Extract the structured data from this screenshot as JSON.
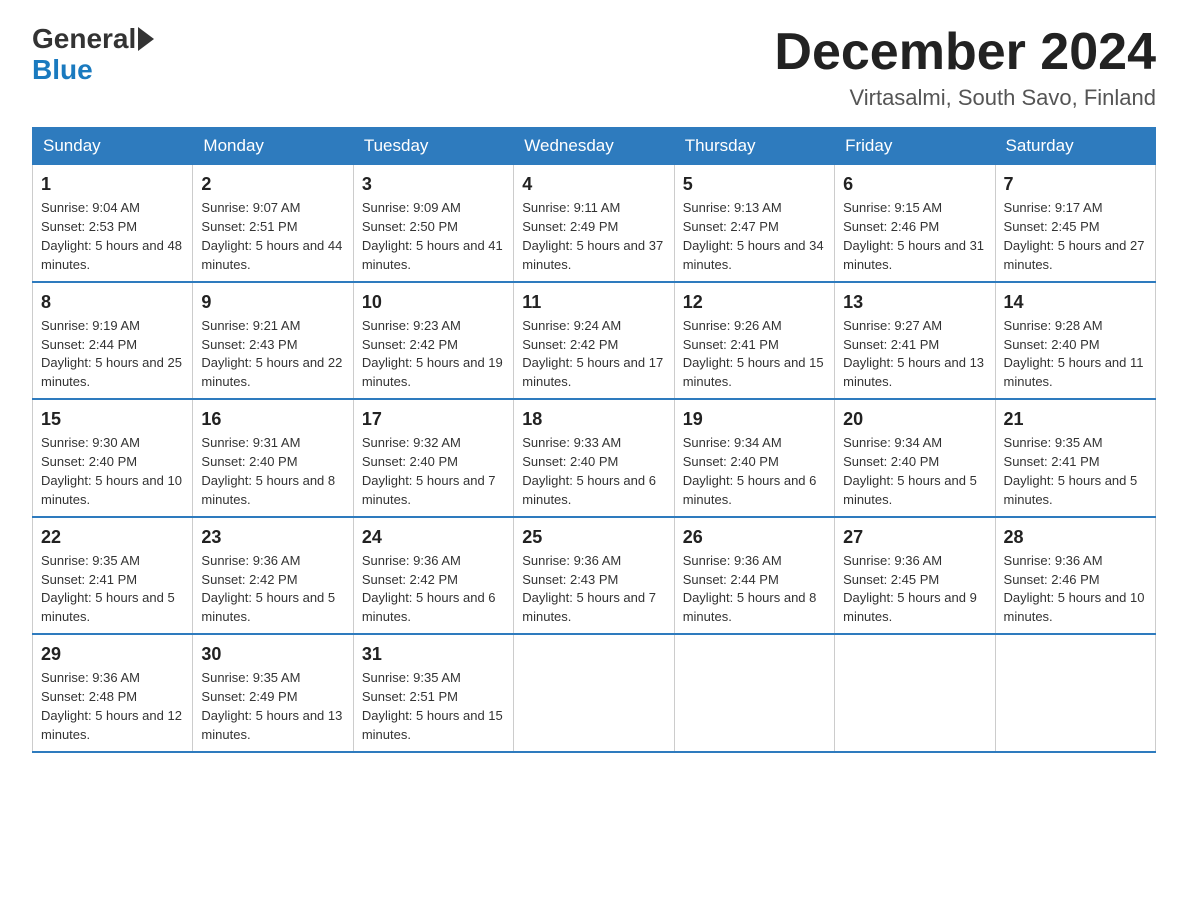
{
  "header": {
    "logo_general": "General",
    "logo_blue": "Blue",
    "month_title": "December 2024",
    "location": "Virtasalmi, South Savo, Finland"
  },
  "weekdays": [
    "Sunday",
    "Monday",
    "Tuesday",
    "Wednesday",
    "Thursday",
    "Friday",
    "Saturday"
  ],
  "weeks": [
    [
      {
        "day": "1",
        "sunrise": "9:04 AM",
        "sunset": "2:53 PM",
        "daylight": "5 hours and 48 minutes."
      },
      {
        "day": "2",
        "sunrise": "9:07 AM",
        "sunset": "2:51 PM",
        "daylight": "5 hours and 44 minutes."
      },
      {
        "day": "3",
        "sunrise": "9:09 AM",
        "sunset": "2:50 PM",
        "daylight": "5 hours and 41 minutes."
      },
      {
        "day": "4",
        "sunrise": "9:11 AM",
        "sunset": "2:49 PM",
        "daylight": "5 hours and 37 minutes."
      },
      {
        "day": "5",
        "sunrise": "9:13 AM",
        "sunset": "2:47 PM",
        "daylight": "5 hours and 34 minutes."
      },
      {
        "day": "6",
        "sunrise": "9:15 AM",
        "sunset": "2:46 PM",
        "daylight": "5 hours and 31 minutes."
      },
      {
        "day": "7",
        "sunrise": "9:17 AM",
        "sunset": "2:45 PM",
        "daylight": "5 hours and 27 minutes."
      }
    ],
    [
      {
        "day": "8",
        "sunrise": "9:19 AM",
        "sunset": "2:44 PM",
        "daylight": "5 hours and 25 minutes."
      },
      {
        "day": "9",
        "sunrise": "9:21 AM",
        "sunset": "2:43 PM",
        "daylight": "5 hours and 22 minutes."
      },
      {
        "day": "10",
        "sunrise": "9:23 AM",
        "sunset": "2:42 PM",
        "daylight": "5 hours and 19 minutes."
      },
      {
        "day": "11",
        "sunrise": "9:24 AM",
        "sunset": "2:42 PM",
        "daylight": "5 hours and 17 minutes."
      },
      {
        "day": "12",
        "sunrise": "9:26 AM",
        "sunset": "2:41 PM",
        "daylight": "5 hours and 15 minutes."
      },
      {
        "day": "13",
        "sunrise": "9:27 AM",
        "sunset": "2:41 PM",
        "daylight": "5 hours and 13 minutes."
      },
      {
        "day": "14",
        "sunrise": "9:28 AM",
        "sunset": "2:40 PM",
        "daylight": "5 hours and 11 minutes."
      }
    ],
    [
      {
        "day": "15",
        "sunrise": "9:30 AM",
        "sunset": "2:40 PM",
        "daylight": "5 hours and 10 minutes."
      },
      {
        "day": "16",
        "sunrise": "9:31 AM",
        "sunset": "2:40 PM",
        "daylight": "5 hours and 8 minutes."
      },
      {
        "day": "17",
        "sunrise": "9:32 AM",
        "sunset": "2:40 PM",
        "daylight": "5 hours and 7 minutes."
      },
      {
        "day": "18",
        "sunrise": "9:33 AM",
        "sunset": "2:40 PM",
        "daylight": "5 hours and 6 minutes."
      },
      {
        "day": "19",
        "sunrise": "9:34 AM",
        "sunset": "2:40 PM",
        "daylight": "5 hours and 6 minutes."
      },
      {
        "day": "20",
        "sunrise": "9:34 AM",
        "sunset": "2:40 PM",
        "daylight": "5 hours and 5 minutes."
      },
      {
        "day": "21",
        "sunrise": "9:35 AM",
        "sunset": "2:41 PM",
        "daylight": "5 hours and 5 minutes."
      }
    ],
    [
      {
        "day": "22",
        "sunrise": "9:35 AM",
        "sunset": "2:41 PM",
        "daylight": "5 hours and 5 minutes."
      },
      {
        "day": "23",
        "sunrise": "9:36 AM",
        "sunset": "2:42 PM",
        "daylight": "5 hours and 5 minutes."
      },
      {
        "day": "24",
        "sunrise": "9:36 AM",
        "sunset": "2:42 PM",
        "daylight": "5 hours and 6 minutes."
      },
      {
        "day": "25",
        "sunrise": "9:36 AM",
        "sunset": "2:43 PM",
        "daylight": "5 hours and 7 minutes."
      },
      {
        "day": "26",
        "sunrise": "9:36 AM",
        "sunset": "2:44 PM",
        "daylight": "5 hours and 8 minutes."
      },
      {
        "day": "27",
        "sunrise": "9:36 AM",
        "sunset": "2:45 PM",
        "daylight": "5 hours and 9 minutes."
      },
      {
        "day": "28",
        "sunrise": "9:36 AM",
        "sunset": "2:46 PM",
        "daylight": "5 hours and 10 minutes."
      }
    ],
    [
      {
        "day": "29",
        "sunrise": "9:36 AM",
        "sunset": "2:48 PM",
        "daylight": "5 hours and 12 minutes."
      },
      {
        "day": "30",
        "sunrise": "9:35 AM",
        "sunset": "2:49 PM",
        "daylight": "5 hours and 13 minutes."
      },
      {
        "day": "31",
        "sunrise": "9:35 AM",
        "sunset": "2:51 PM",
        "daylight": "5 hours and 15 minutes."
      },
      null,
      null,
      null,
      null
    ]
  ]
}
